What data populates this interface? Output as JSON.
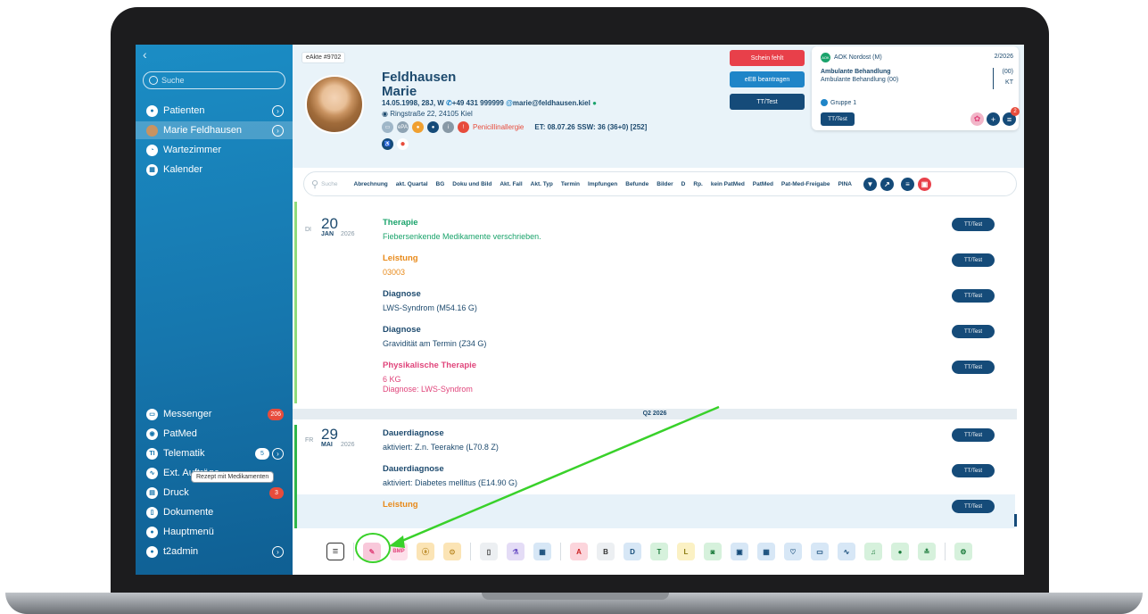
{
  "sidebar": {
    "back": "‹",
    "search_placeholder": "Suche",
    "items": [
      {
        "label": "Patienten",
        "icon": "person-icon"
      },
      {
        "label": "Marie Feldhausen",
        "icon": "avatar"
      },
      {
        "label": "Wartezimmer",
        "icon": "clock-icon"
      },
      {
        "label": "Kalender",
        "icon": "calendar-icon"
      }
    ],
    "bottom_items": [
      {
        "label": "Messenger",
        "badge": "206"
      },
      {
        "label": "PatMed"
      },
      {
        "label": "Telematik",
        "badge": "5"
      },
      {
        "label": "Ext. Aufträge"
      },
      {
        "label": "Druck",
        "badge": "3"
      },
      {
        "label": "Dokumente"
      },
      {
        "label": "Hauptmenü"
      },
      {
        "label": "t2admin"
      }
    ]
  },
  "header": {
    "eakte": "eAkte #9702",
    "last_name": "Feldhausen",
    "first_name": "Marie",
    "info": "14.05.1998, 28J, W",
    "phone": "+49 431 999999",
    "email": "marie@feldhausen.kiel",
    "address": "Ringstraße 22, 24105 Kiel",
    "allergy": "Penicillinallergie",
    "et": "ET: 08.07.26 SSW: 36 (36+0) [252]",
    "btn_schein": "Schein fehlt",
    "btn_eeb": "eEB beantragen",
    "btn_tt": "TT/Test"
  },
  "insurance": {
    "name": "AOK Nordost (M)",
    "quarter": "2/2026",
    "type": "Ambulante Behandlung",
    "type_sub": "Ambulante Behandlung (00)",
    "code": "(00)",
    "kt": "KT",
    "group": "Gruppe 1",
    "tt": "TT/Test",
    "cart_badge": "2"
  },
  "filters": {
    "search_placeholder": "Suche",
    "items": [
      "Abrechnung",
      "akt. Quartal",
      "BG",
      "Doku und Bild",
      "Akt. Fall",
      "Akt. Typ",
      "Termin",
      "Impfungen",
      "Befunde",
      "Bilder",
      "D",
      "Rp.",
      "kein PatMed",
      "PatMed",
      "Pat-Med-Freigabe",
      "PINA"
    ]
  },
  "timeline": {
    "day1": {
      "weekday": "DI",
      "day": "20",
      "month": "JAN",
      "year": "2026"
    },
    "day2": {
      "weekday": "FR",
      "day": "29",
      "month": "MAI",
      "year": "2026"
    },
    "quarter": "Q2 2026",
    "entries": [
      {
        "title": "Therapie",
        "value": "Fiebersenkende Medikamente verschrieben.",
        "color": "#1aa36b"
      },
      {
        "title": "Leistung",
        "value": "03003",
        "color": "#e88a1a"
      },
      {
        "title": "Diagnose",
        "value": "LWS-Syndrom (M54.16 G)",
        "color": "#1d4a6e"
      },
      {
        "title": "Diagnose",
        "value": "Gravidität am Termin (Z34 G)",
        "color": "#1d4a6e"
      },
      {
        "title": "Physikalische Therapie",
        "value": "6 KG",
        "value2": "Diagnose: LWS-Syndrom",
        "color": "#e0457b"
      },
      {
        "title": "Dauerdiagnose",
        "value": "aktiviert: Z.n. Teerakne (L70.8 Z)",
        "color": "#1d4a6e"
      },
      {
        "title": "Dauerdiagnose",
        "value": "aktiviert: Diabetes mellitus (E14.90 G)",
        "color": "#1d4a6e"
      },
      {
        "title": "Leistung",
        "value": "",
        "color": "#e88a1a"
      }
    ],
    "tt_label": "TT/Test"
  },
  "tooltip": "Rezept mit Medikamenten",
  "toolbar": {
    "letters": [
      "A",
      "B",
      "D",
      "T",
      "L"
    ],
    "bmp": "BMP"
  },
  "colors": {
    "accent": "#1676ad",
    "dark_button": "#154b79",
    "highlight": "#39d12a"
  }
}
